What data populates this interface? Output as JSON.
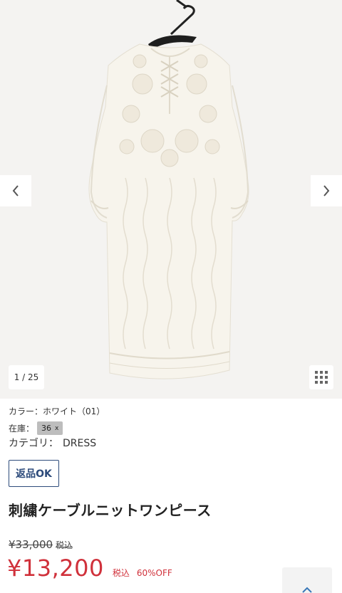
{
  "gallery": {
    "counter": "1 / 25",
    "colors": {
      "background": "#f4f3f1",
      "dress": "#f7f4ec"
    }
  },
  "product": {
    "color_label": "カラー：ホワイト（01）",
    "stock_label": "在庫：",
    "size_chip": "36",
    "size_chip_mark": "x",
    "category_label": "カテゴリ：",
    "category_value": "DRESS",
    "return_badge": "返品OK",
    "title": "刺繍ケーブルニットワンピース"
  },
  "price": {
    "original": "¥33,000",
    "original_tax": "税込",
    "sale": "¥13,200",
    "sale_tax": "税込",
    "discount": "60%OFF",
    "accent_color": "#d0313b"
  },
  "icons": {
    "prev": "chevron-left-icon",
    "next": "chevron-right-icon",
    "grid": "grid-icon",
    "scroll_top": "arrow-up-icon"
  }
}
